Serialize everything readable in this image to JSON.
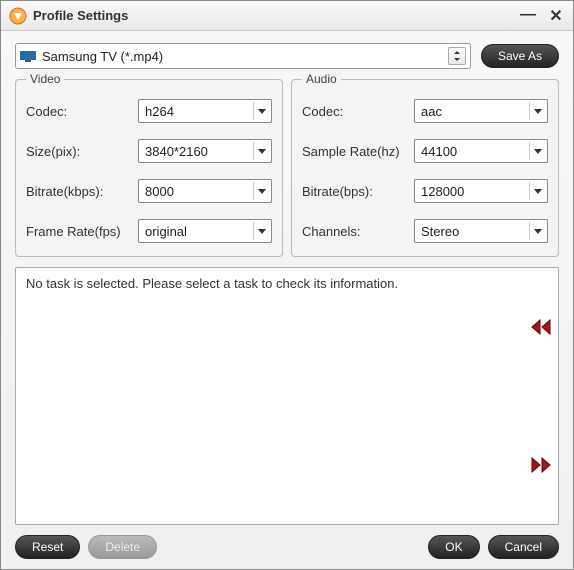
{
  "window": {
    "title": "Profile Settings"
  },
  "profile": {
    "selected": "Samsung TV (*.mp4)",
    "save_as": "Save As"
  },
  "video": {
    "title": "Video",
    "codec_label": "Codec:",
    "codec_value": "h264",
    "size_label": "Size(pix):",
    "size_value": "3840*2160",
    "bitrate_label": "Bitrate(kbps):",
    "bitrate_value": "8000",
    "framerate_label": "Frame Rate(fps)",
    "framerate_value": "original"
  },
  "audio": {
    "title": "Audio",
    "codec_label": "Codec:",
    "codec_value": "aac",
    "samplerate_label": "Sample Rate(hz)",
    "samplerate_value": "44100",
    "bitrate_label": "Bitrate(bps):",
    "bitrate_value": "128000",
    "channels_label": "Channels:",
    "channels_value": "Stereo"
  },
  "task": {
    "message": "No task is selected. Please select a task to check its information."
  },
  "footer": {
    "reset": "Reset",
    "delete": "Delete",
    "ok": "OK",
    "cancel": "Cancel"
  }
}
